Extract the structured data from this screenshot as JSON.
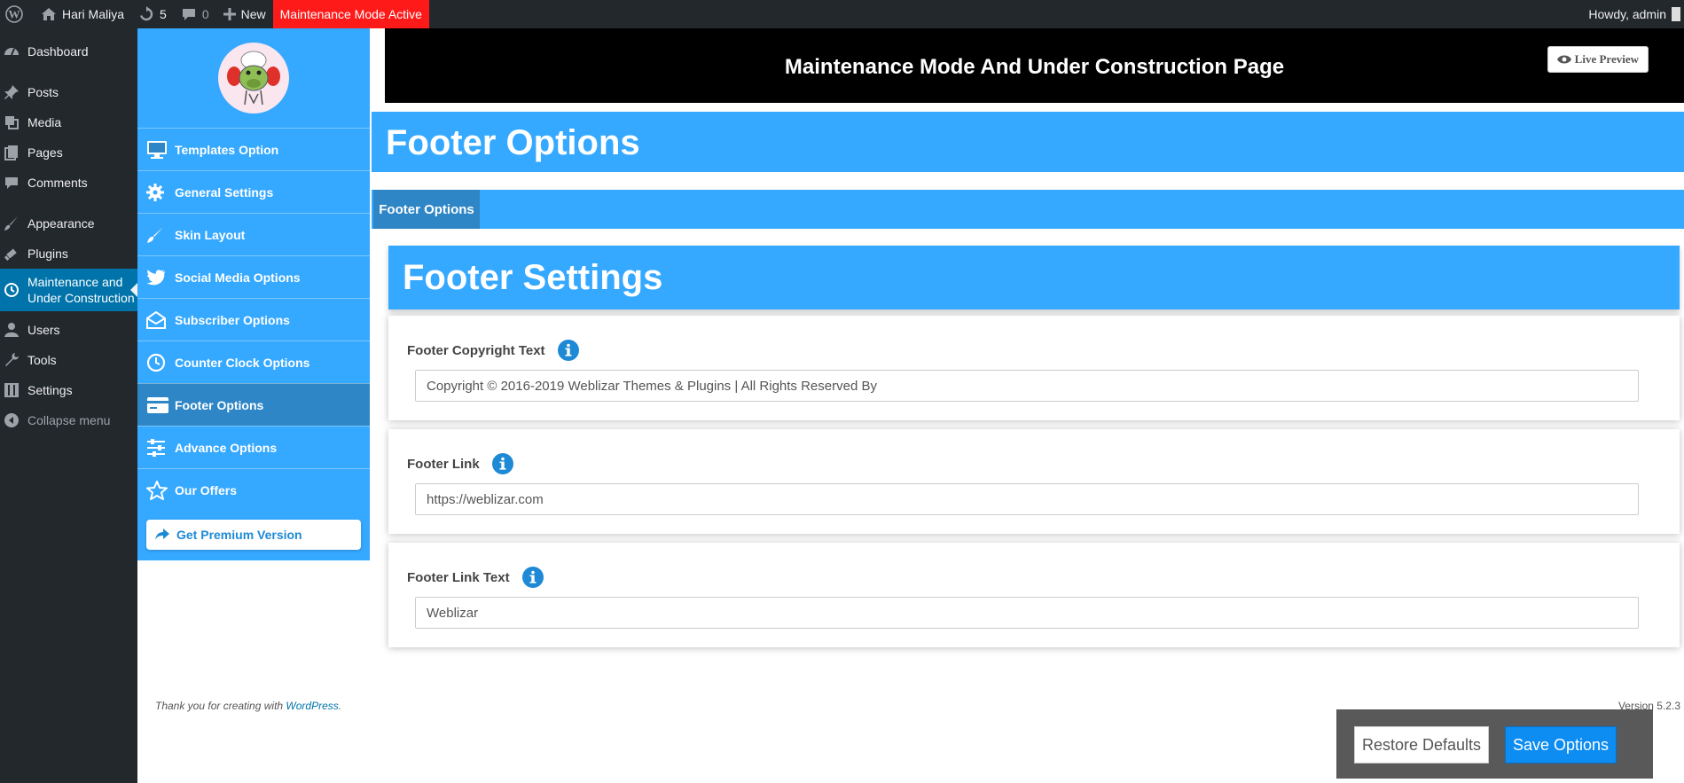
{
  "admin_bar": {
    "site_name": "Hari Maliya",
    "updates_count": "5",
    "comments_count": "0",
    "new_label": "New",
    "maintenance_badge": "Maintenance Mode Active",
    "howdy": "Howdy, admin"
  },
  "admin_menu": {
    "dashboard": "Dashboard",
    "posts": "Posts",
    "media": "Media",
    "pages": "Pages",
    "comments": "Comments",
    "appearance": "Appearance",
    "plugins": "Plugins",
    "maintenance_line1": "Maintenance and",
    "maintenance_line2": "Under Construction",
    "users": "Users",
    "tools": "Tools",
    "settings": "Settings",
    "collapse": "Collapse menu"
  },
  "plugin_nav": {
    "items": [
      {
        "label": "Templates Option",
        "icon": "monitor-icon"
      },
      {
        "label": "General Settings",
        "icon": "gear-icon"
      },
      {
        "label": "Skin Layout",
        "icon": "brush-icon"
      },
      {
        "label": "Social Media Options",
        "icon": "twitter-icon"
      },
      {
        "label": "Subscriber Options",
        "icon": "envelope-open-icon"
      },
      {
        "label": "Counter Clock Options",
        "icon": "clock-icon"
      },
      {
        "label": "Footer Options",
        "icon": "credit-card-icon"
      },
      {
        "label": "Advance Options",
        "icon": "sliders-icon"
      },
      {
        "label": "Our Offers",
        "icon": "star-icon"
      }
    ],
    "active_index": 6,
    "premium_label": "Get Premium Version"
  },
  "header": {
    "title": "Maintenance Mode And Under Construction Page",
    "live_preview": "Live Preview"
  },
  "page": {
    "title": "Footer Options",
    "tab_active": "Footer Options",
    "settings_title": "Footer Settings"
  },
  "fields": {
    "copyright": {
      "label": "Footer Copyright Text",
      "value": "Copyright © 2016-2019 Weblizar Themes & Plugins | All Rights Reserved By"
    },
    "link": {
      "label": "Footer Link",
      "value": "https://weblizar.com"
    },
    "link_text": {
      "label": "Footer Link Text",
      "value": "Weblizar"
    }
  },
  "footer": {
    "thanks_prefix": "Thank you for creating with",
    "wordpress_link": "WordPress",
    "thanks_suffix": ".",
    "version": "Version 5.2.3"
  },
  "actions": {
    "restore": "Restore Defaults",
    "save": "Save Options"
  },
  "colors": {
    "wp_dark": "#23282d",
    "wp_active_blue": "#0073aa",
    "plugin_blue": "#35a8ff",
    "plugin_blue_active": "#2e86c6",
    "maintenance_red": "#ff1a1a",
    "info_icon_blue": "#1e8ad6",
    "save_blue": "#0d8cf2"
  }
}
